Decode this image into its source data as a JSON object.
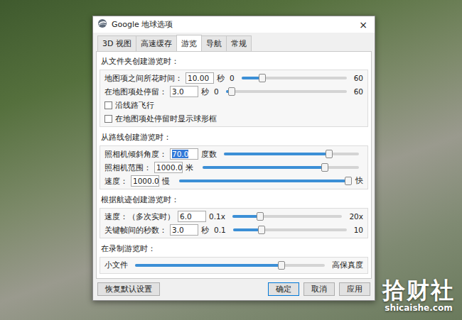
{
  "window": {
    "title": "Google 地球选项",
    "close": "×"
  },
  "tabs": [
    {
      "label": "3D 视图",
      "selected": false
    },
    {
      "label": "高速缓存",
      "selected": false
    },
    {
      "label": "游览",
      "selected": true
    },
    {
      "label": "导航",
      "selected": false
    },
    {
      "label": "常规",
      "selected": false
    }
  ],
  "sections": [
    {
      "title": "从文件夹创建游览时：",
      "rows": [
        {
          "kind": "slider",
          "label": "地图项之间所花时间：",
          "value": "10.00",
          "highlighted": false,
          "unit": "秒",
          "min": "0",
          "max": "60",
          "level": 0.2
        },
        {
          "kind": "slider",
          "label": "在地图项处停留：",
          "value": "3.0",
          "highlighted": false,
          "unit": "秒",
          "min": "0",
          "max": "60",
          "level": 0.05
        },
        {
          "kind": "checkbox",
          "label": "沿线路飞行",
          "checked": false
        },
        {
          "kind": "checkbox",
          "label": "在地图项处停留时显示球形框",
          "checked": false
        }
      ]
    },
    {
      "title": "从路线创建游览时：",
      "rows": [
        {
          "kind": "slider",
          "label": "照相机倾斜角度：",
          "value": "70.0",
          "highlighted": true,
          "unit": "度数",
          "level": 0.78
        },
        {
          "kind": "slider",
          "label": "照相机范围：",
          "value": "1000.0",
          "highlighted": false,
          "unit": "米",
          "level": 0.78
        },
        {
          "kind": "slider",
          "label": "速度：",
          "value": "1000.0",
          "highlighted": false,
          "unit": "慢",
          "max": "快",
          "level": 1.0
        }
      ]
    },
    {
      "title": "根据航迹创建游览时：",
      "rows": [
        {
          "kind": "slider",
          "label": "速度：（多次实时）",
          "value": "6.0",
          "highlighted": false,
          "min": "0.1x",
          "max": "20x",
          "level": 0.25
        },
        {
          "kind": "slider",
          "label": "关键帧间的秒数：",
          "value": "3.0",
          "highlighted": false,
          "unit": "秒",
          "min": "0.1",
          "max": "10",
          "level": 0.25
        }
      ]
    },
    {
      "title": "在录制游览时：",
      "rows": [
        {
          "kind": "slider",
          "min": "小文件",
          "max": "高保真度",
          "level": 0.77
        }
      ]
    }
  ],
  "buttons": {
    "reset": "恢复默认设置",
    "ok": "确定",
    "cancel": "取消",
    "apply": "应用"
  },
  "watermark": {
    "title": "拾财社",
    "url": "shicaishe.com"
  }
}
